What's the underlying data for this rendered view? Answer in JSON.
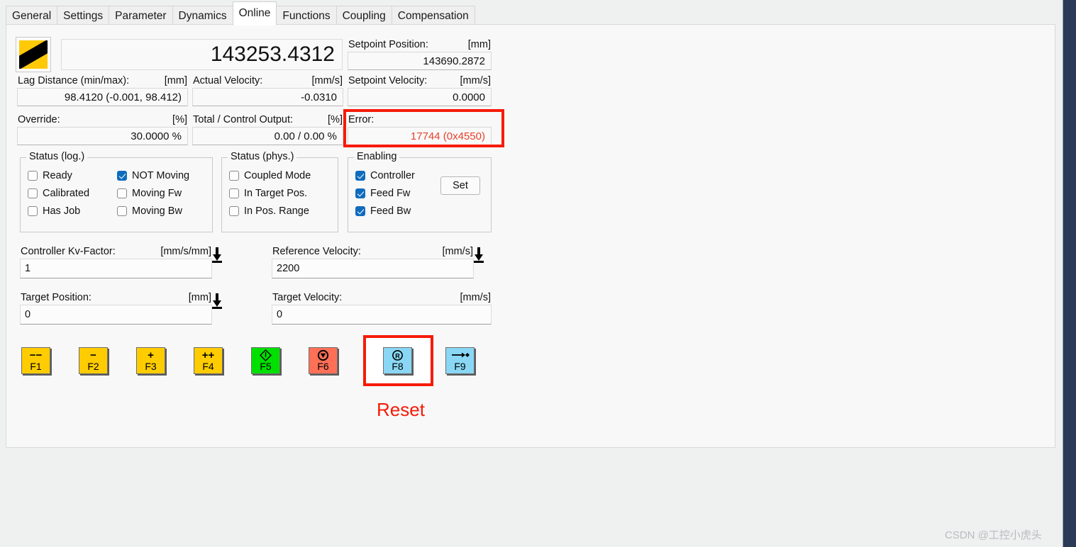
{
  "tabs": [
    {
      "label": "General",
      "active": false
    },
    {
      "label": "Settings",
      "active": false
    },
    {
      "label": "Parameter",
      "active": false
    },
    {
      "label": "Dynamics",
      "active": false
    },
    {
      "label": "Online",
      "active": true
    },
    {
      "label": "Functions",
      "active": false
    },
    {
      "label": "Coupling",
      "active": false
    },
    {
      "label": "Compensation",
      "active": false
    }
  ],
  "readout": {
    "hazard_icon": "hazard-stripe-icon",
    "actual_position_value": "143253.4312"
  },
  "fields": {
    "setpoint_position": {
      "label": "Setpoint Position:",
      "unit": "[mm]",
      "value": "143690.2872"
    },
    "lag_distance": {
      "label": "Lag Distance (min/max):",
      "unit": "[mm]",
      "value": "98.4120  (-0.001, 98.412)"
    },
    "actual_velocity": {
      "label": "Actual Velocity:",
      "unit": "[mm/s]",
      "value": "-0.0310"
    },
    "setpoint_velocity": {
      "label": "Setpoint Velocity:",
      "unit": "[mm/s]",
      "value": "0.0000"
    },
    "override": {
      "label": "Override:",
      "unit": "[%]",
      "value": "30.0000 %"
    },
    "control_output": {
      "label": "Total / Control Output:",
      "unit": "[%]",
      "value": "0.00 /  0.00 %"
    },
    "error": {
      "label": "Error:",
      "unit": "",
      "value": "17744 (0x4550)",
      "color": "#e8402a"
    }
  },
  "status_log": {
    "title": "Status (log.)",
    "left": [
      {
        "label": "Ready",
        "checked": false
      },
      {
        "label": "Calibrated",
        "checked": false
      },
      {
        "label": "Has Job",
        "checked": false
      }
    ],
    "right": [
      {
        "label": "NOT Moving",
        "checked": true
      },
      {
        "label": "Moving Fw",
        "checked": false
      },
      {
        "label": "Moving Bw",
        "checked": false
      }
    ]
  },
  "status_phys": {
    "title": "Status (phys.)",
    "items": [
      {
        "label": "Coupled Mode",
        "checked": false
      },
      {
        "label": "In Target Pos.",
        "checked": false
      },
      {
        "label": "In Pos. Range",
        "checked": false
      }
    ]
  },
  "enabling": {
    "title": "Enabling",
    "items": [
      {
        "label": "Controller",
        "checked": true
      },
      {
        "label": "Feed Fw",
        "checked": true
      },
      {
        "label": "Feed Bw",
        "checked": true
      }
    ],
    "set_button": "Set"
  },
  "inputs": {
    "kv_factor": {
      "label": "Controller Kv-Factor:",
      "unit": "[mm/s/mm]",
      "value": "1",
      "has_spinner": true
    },
    "reference_velocity": {
      "label": "Reference Velocity:",
      "unit": "[mm/s]",
      "value": "2200",
      "has_spinner": true
    },
    "target_position": {
      "label": "Target Position:",
      "unit": "[mm]",
      "value": "0",
      "has_spinner": true
    },
    "target_velocity": {
      "label": "Target Velocity:",
      "unit": "[mm/s]",
      "value": "0",
      "has_spinner": false
    }
  },
  "fkeys": [
    {
      "key": "F1",
      "glyph": "−−",
      "color": "#ffcc00",
      "name": "jog-fast-backward"
    },
    {
      "key": "F2",
      "glyph": "−",
      "color": "#ffcc00",
      "name": "jog-backward"
    },
    {
      "key": "F3",
      "glyph": "+",
      "color": "#ffcc00",
      "name": "jog-forward"
    },
    {
      "key": "F4",
      "glyph": "++",
      "color": "#ffcc00",
      "name": "jog-fast-forward"
    },
    {
      "key": "F5",
      "glyph": "power-diamond-icon",
      "color": "#00e000",
      "name": "enable"
    },
    {
      "key": "F6",
      "glyph": "stop-circle-icon",
      "color": "#ff7057",
      "name": "stop"
    },
    {
      "key": "F8",
      "glyph": "reset-r-icon",
      "color": "#8ad7f5",
      "name": "reset"
    },
    {
      "key": "F9",
      "glyph": "move-to-target-icon",
      "color": "#8ad7f5",
      "name": "move-to-target"
    }
  ],
  "annotation": {
    "reset_label": "Reset",
    "highlight_color": "#f61b09"
  },
  "watermark": "CSDN @工控小虎头"
}
